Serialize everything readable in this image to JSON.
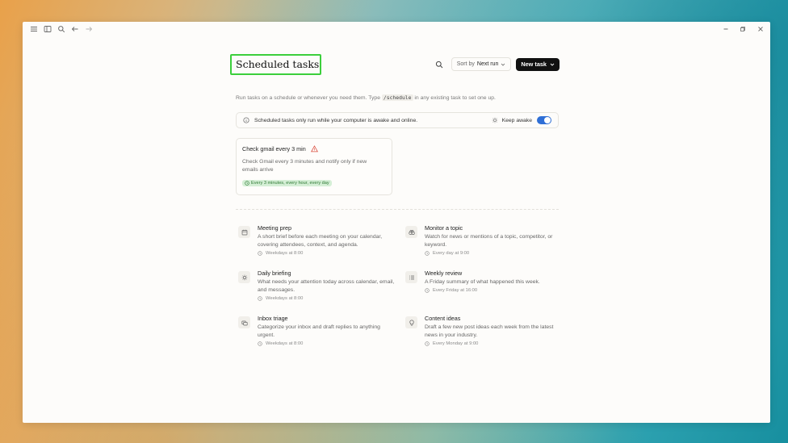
{
  "page": {
    "title": "Scheduled tasks",
    "subtitle_before": "Run tasks on a schedule or whenever you need them. Type",
    "subtitle_code": "/schedule",
    "subtitle_after": "in any existing task to set one up."
  },
  "header": {
    "sort_prefix": "Sort by",
    "sort_value": "Next run",
    "new_task_label": "New task"
  },
  "banner": {
    "text": "Scheduled tasks only run while your computer is awake and online.",
    "keep_awake_label": "Keep awake",
    "keep_awake_on": true
  },
  "task": {
    "title": "Check gmail every 3 min",
    "description": "Check Gmail every 3 minutes and notify only if new emails arrive",
    "schedule": "Every 3 minutes, every hour, every day"
  },
  "templates": [
    {
      "title": "Meeting prep",
      "description": "A short brief before each meeting on your calendar, covering attendees, context, and agenda.",
      "schedule": "Weekdays at 8:00",
      "icon": "calendar-icon"
    },
    {
      "title": "Monitor a topic",
      "description": "Watch for news or mentions of a topic, competitor, or keyword.",
      "schedule": "Every day at 9:00",
      "icon": "binoculars-icon"
    },
    {
      "title": "Daily briefing",
      "description": "What needs your attention today across calendar, email, and messages.",
      "schedule": "Weekdays at 8:00",
      "icon": "sun-icon"
    },
    {
      "title": "Weekly review",
      "description": "A Friday summary of what happened this week.",
      "schedule": "Every Friday at 16:00",
      "icon": "list-icon"
    },
    {
      "title": "Inbox triage",
      "description": "Categorize your inbox and draft replies to anything urgent.",
      "schedule": "Weekdays at 8:00",
      "icon": "inbox-icon"
    },
    {
      "title": "Content ideas",
      "description": "Draft a few new post ideas each week from the latest news in your industry.",
      "schedule": "Every Monday at 9:00",
      "icon": "lightbulb-icon"
    }
  ],
  "colors": {
    "highlight_box": "#3ccf3c",
    "toggle_on": "#2f6fd6",
    "badge_bg": "#d5efd6",
    "warning": "#d94a3a"
  }
}
